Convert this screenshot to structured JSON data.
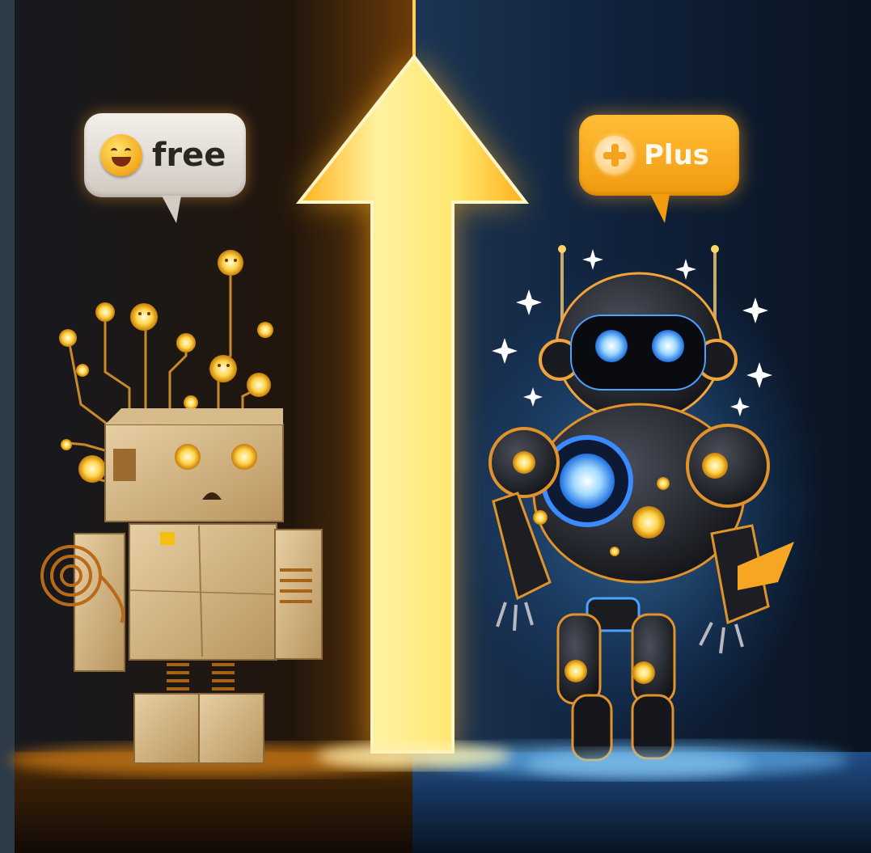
{
  "labels": {
    "free": "free",
    "plus": "Plus"
  },
  "icons": {
    "free": "smiling-face-icon",
    "plus": "plus-circle-icon",
    "upgrade": "up-arrow-icon"
  },
  "colors": {
    "free_side": "#1b1612",
    "plus_side": "#0c1626",
    "arrow_glow": "#ffd23f",
    "plus_bubble": "#f6a623",
    "robot_eye_glow": "#3fa0ff"
  }
}
